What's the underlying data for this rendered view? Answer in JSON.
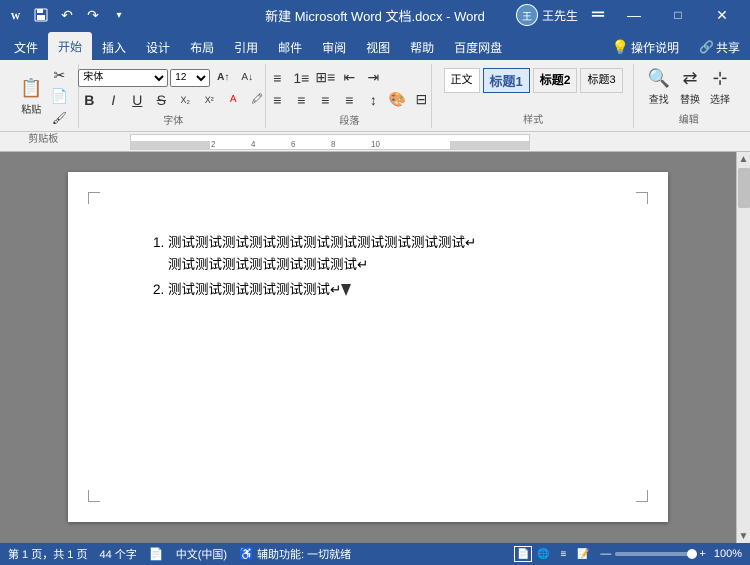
{
  "titlebar": {
    "title": "新建 Microsoft Word 文档.docx - Word",
    "appname": "Word",
    "username": "王先生",
    "avatar_initial": "王",
    "min_label": "—",
    "max_label": "□",
    "close_label": "✕"
  },
  "quickaccess": {
    "save_label": "💾",
    "undo_label": "↶",
    "redo_label": "↷",
    "dropdown_label": "▾"
  },
  "ribbon": {
    "tabs": [
      "文件",
      "开始",
      "插入",
      "设计",
      "布局",
      "引用",
      "邮件",
      "审阅",
      "视图",
      "帮助",
      "百度网盘"
    ],
    "active_tab": "开始",
    "help_icon": "💡",
    "operations_label": "操作说明",
    "share_label": "共享"
  },
  "document": {
    "items": [
      {
        "number": "1.",
        "line1": "测试测试测试测试测试测试测试测试测试测试测试↵",
        "line2": "测试测试测试测试测试测试测试↵"
      },
      {
        "number": "2.",
        "line1": "测试测试测试测试测试测试↵"
      }
    ]
  },
  "statusbar": {
    "page_info": "第 1 页，共 1 页",
    "word_count": "44 个字",
    "track_icon": "📄",
    "language": "中文(中国)",
    "accessibility": "辅助功能: 一切就绪",
    "zoom_percent": "100%",
    "zoom_minus": "—",
    "zoom_plus": "+"
  }
}
